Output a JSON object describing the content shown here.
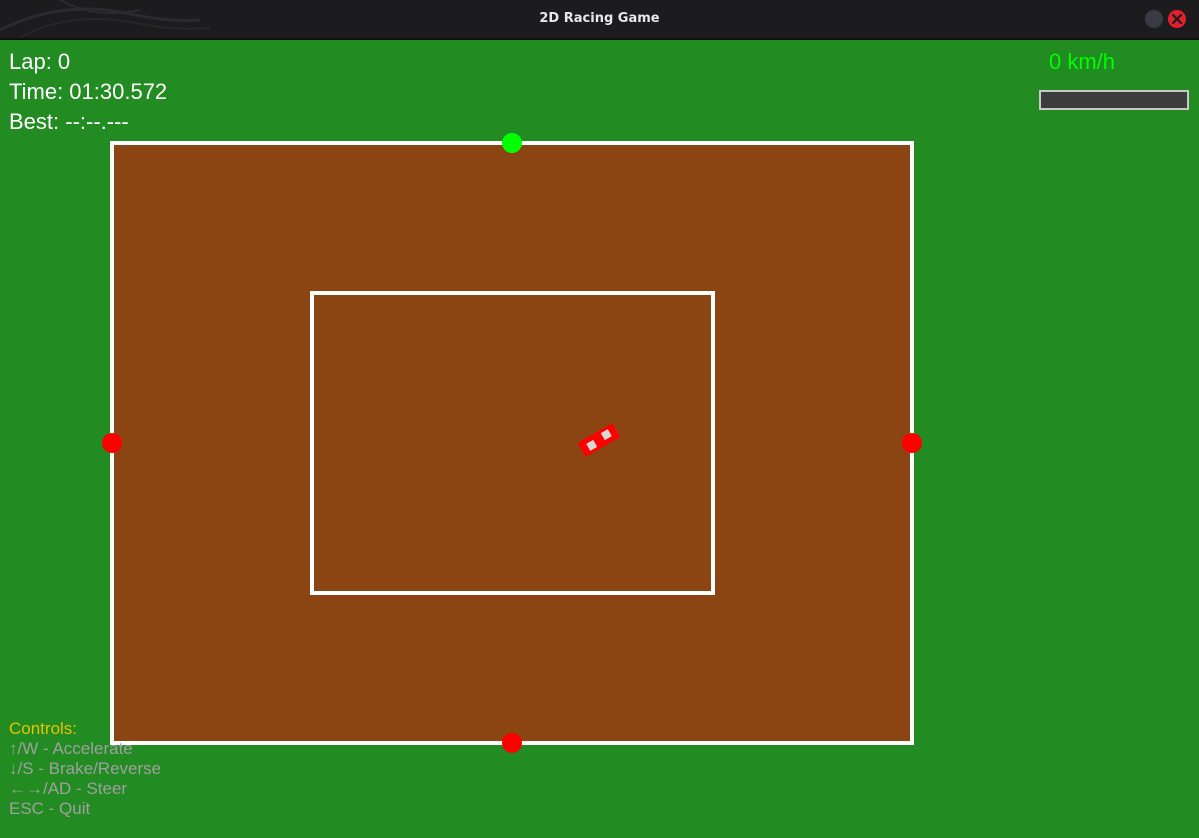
{
  "window": {
    "title": "2D Racing Game"
  },
  "hud": {
    "lap": "Lap: 0",
    "time": "Time: 01:30.572",
    "best": "Best: --:--.---",
    "speed": "0 km/h",
    "speed_fraction": 0
  },
  "controls": {
    "title": "Controls:",
    "lines": [
      "↑/W - Accelerate",
      "↓/S - Brake/Reverse",
      "←→/AD - Steer",
      "ESC - Quit"
    ]
  },
  "colors": {
    "grass": "#228b22",
    "track": "#8b4513",
    "boundary": "#ffffff",
    "start_checkpoint": "#00ff00",
    "checkpoint": "#ff0000",
    "car": "#ff0000",
    "speed_text": "#00ff00",
    "controls_title": "#e6c200",
    "controls_text": "#a0a0a0"
  },
  "checkpoints": [
    {
      "type": "start",
      "color": "#00ff00"
    },
    {
      "type": "checkpoint",
      "color": "#ff0000"
    },
    {
      "type": "checkpoint",
      "color": "#ff0000"
    },
    {
      "type": "checkpoint",
      "color": "#ff0000"
    }
  ]
}
